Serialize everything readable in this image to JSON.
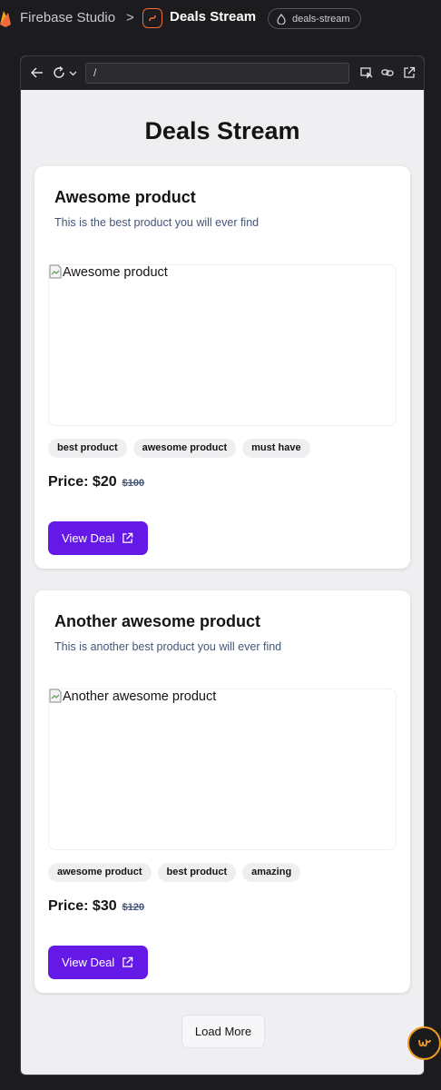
{
  "topbar": {
    "studio_label": "Firebase Studio",
    "separator": ">",
    "app_name": "Deals Stream",
    "branch": "deals-stream"
  },
  "browser": {
    "url": "/"
  },
  "page": {
    "title": "Deals Stream",
    "load_more_label": "Load More"
  },
  "products": [
    {
      "title": "Awesome product",
      "description": "This is the best product you will ever find",
      "image_alt": "Awesome product",
      "tags": [
        "best product",
        "awesome product",
        "must have"
      ],
      "price": "Price: $20",
      "original_price": "$100",
      "button_label": "View Deal"
    },
    {
      "title": "Another awesome product",
      "description": "This is another best product you will ever find",
      "image_alt": "Another awesome product",
      "tags": [
        "awesome product",
        "best product",
        "amazing"
      ],
      "price": "Price: $30",
      "original_price": "$120",
      "button_label": "View Deal"
    }
  ],
  "colors": {
    "accent": "#6519e6",
    "brand_orange": "#f26b3a",
    "muted_text": "#44557a"
  },
  "icons": [
    "firebase-logo",
    "app-icon",
    "branch-icon",
    "back-arrow-icon",
    "reload-icon",
    "chevron-down-icon",
    "inspect-icon",
    "link-icon",
    "open-external-icon",
    "broken-image-icon",
    "external-link-icon",
    "assistant-icon"
  ]
}
